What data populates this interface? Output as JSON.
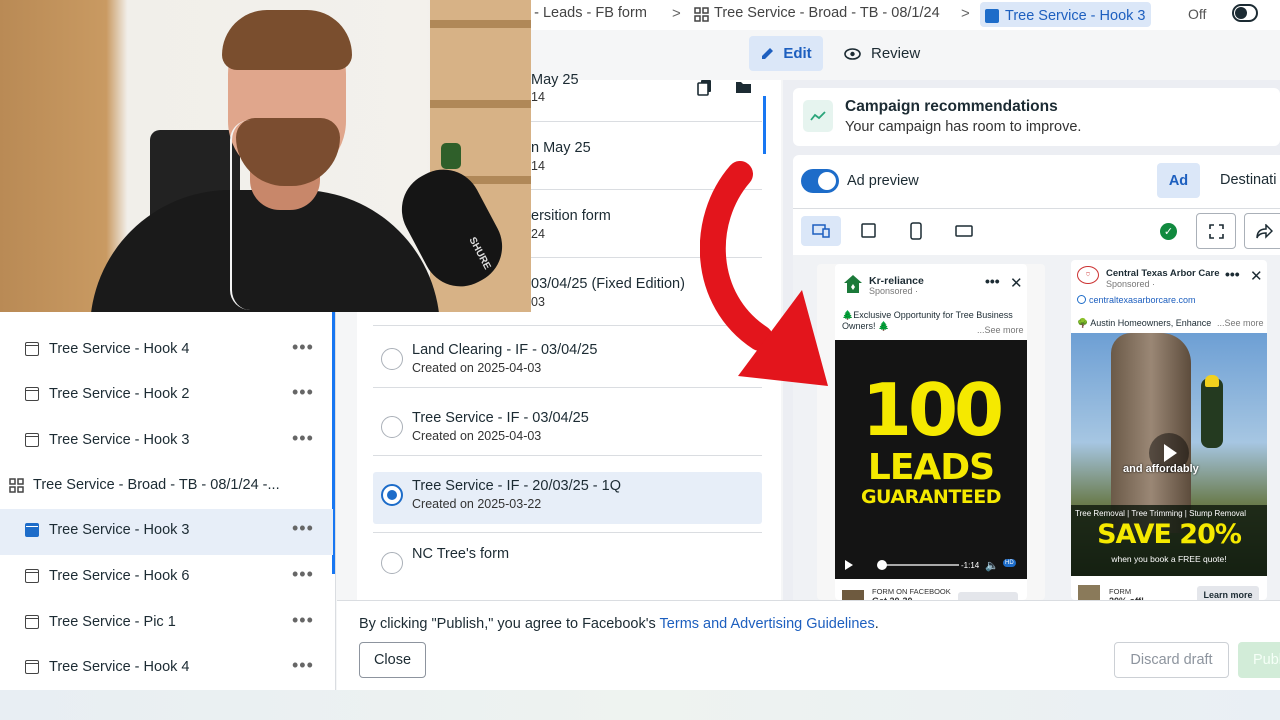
{
  "breadcrumb": {
    "item1": "e - Leads - FB form",
    "item2": "Tree Service - Broad - TB - 08/1/24",
    "item3": "Tree Service - Hook 3",
    "separator": ">"
  },
  "status_toggle": {
    "label": "Off"
  },
  "mode_tabs": {
    "edit": "Edit",
    "review": "Review"
  },
  "left_nav": {
    "items": [
      {
        "label": "Tree Service - Hook 4",
        "type": "ad"
      },
      {
        "label": "Tree Service - Hook 2",
        "type": "ad"
      },
      {
        "label": "Tree Service - Hook 3",
        "type": "ad"
      },
      {
        "label": "Tree Service - Broad - TB - 08/1/24 -...",
        "type": "adset"
      },
      {
        "label": "Tree Service - Hook 3",
        "type": "ad",
        "selected": true
      },
      {
        "label": "Tree Service - Hook 6",
        "type": "ad"
      },
      {
        "label": "Tree Service - Pic 1",
        "type": "ad"
      },
      {
        "label": "Tree Service - Hook 4",
        "type": "ad"
      }
    ],
    "more_glyph": "•••"
  },
  "forms": {
    "partial_rows": [
      {
        "title": "May 25",
        "date": "14"
      },
      {
        "title": "n May 25",
        "date": "14"
      },
      {
        "title": "ersition form",
        "date": "24"
      },
      {
        "title": "03/04/25 (Fixed Edition)",
        "date": "03"
      }
    ],
    "rows": [
      {
        "title": "Land Clearing - IF - 03/04/25",
        "date": "Created on 2025-04-03"
      },
      {
        "title": "Tree Service - IF - 03/04/25",
        "date": "Created on 2025-04-03"
      },
      {
        "title": "Tree Service - IF - 20/03/25 - 1Q",
        "date": "Created on 2025-03-22",
        "selected": true
      },
      {
        "title": "NC Tree's form",
        "date": ""
      }
    ]
  },
  "recommendations": {
    "title": "Campaign recommendations",
    "subtitle": "Your campaign has room to improve."
  },
  "preview": {
    "toggle_label": "Ad preview",
    "tab_ad": "Ad",
    "tab_destination": "Destinati"
  },
  "ad1": {
    "page_name": "Kr-reliance",
    "sponsored": "Sponsored · ",
    "text": "🌲Exclusive Opportunity for Tree Business",
    "text2": "Owners! 🌲",
    "see_more": "...See more",
    "headline_num": "100",
    "headline_word": "LEADS",
    "headline_sub": "GUARANTEED",
    "video_time": "-1:14",
    "hd": "HD",
    "footer_source": "FORM ON FACEBOOK",
    "footer_title": "Get 20-30"
  },
  "ad2": {
    "page_name": "Central Texas Arbor Care",
    "sponsored": "Sponsored · ",
    "url": "centraltexasarborcare.com",
    "text": "🌳 Austin Homeowners, Enhance",
    "see_more": "...See more",
    "caption": "and affordably",
    "services": "Tree Removal | Tree Trimming | Stump Removal",
    "save": "SAVE 20%",
    "book": "when you book a FREE quote!",
    "footer_source": "FORM",
    "footer_title": "20% off!",
    "cta": "Learn more"
  },
  "footer": {
    "terms_prefix": "By clicking \"Publish,\" you agree to Facebook's ",
    "terms_link": "Terms and Advertising Guidelines",
    "terms_suffix": ".",
    "close": "Close",
    "discard": "Discard draft",
    "publish": "Publ"
  },
  "webcam": {
    "mic_brand": "SHURE"
  },
  "icons": {
    "edit": "pencil-icon",
    "review": "eye-icon",
    "close": "close-icon",
    "more": "more-icon"
  },
  "colors": {
    "accent": "#1d6cc9",
    "selected_bg": "#e7eef8",
    "headline_yellow": "#f5e900",
    "arrow_red": "#e3151c",
    "success": "#118a3f"
  }
}
